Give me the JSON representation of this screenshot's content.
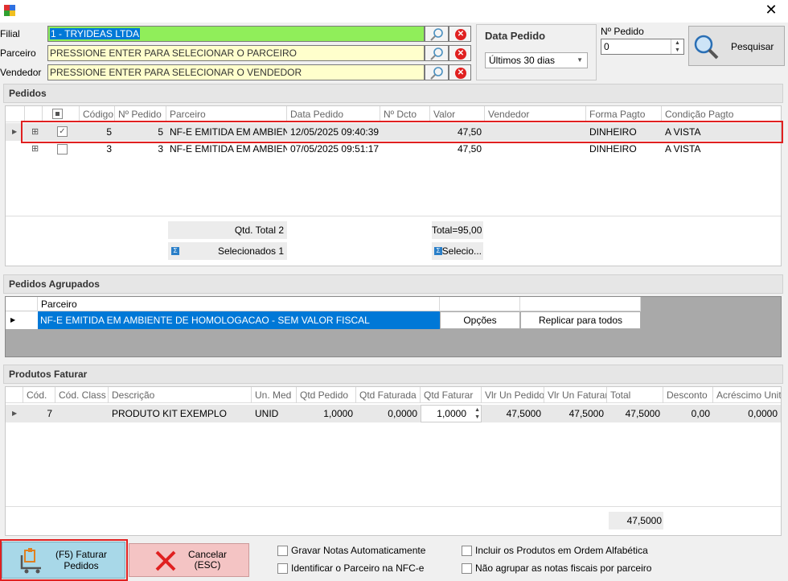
{
  "labels": {
    "filial": "Filial",
    "parceiro": "Parceiro",
    "vendedor": "Vendedor",
    "nro_pedido": "Nº Pedido",
    "data_pedido": "Data Pedido"
  },
  "fields": {
    "filial": "1 - TRYIDEAS LTDA",
    "parceiro": "PRESSIONE ENTER PARA SELECIONAR O PARCEIRO",
    "vendedor": "PRESSIONE ENTER PARA SELECIONAR O VENDEDOR",
    "nro_pedido": "0",
    "data_pedido_option": "Últimos 30 dias"
  },
  "search_button": "Pesquisar",
  "pedidos": {
    "title": "Pedidos",
    "columns": [
      "Código",
      "Nº Pedido",
      "Parceiro",
      "Data Pedido",
      "Nº Dcto",
      "Valor",
      "Vendedor",
      "Forma Pagto",
      "Condição Pagto"
    ],
    "rows": [
      {
        "checked": true,
        "codigo": "5",
        "nro": "5",
        "parceiro": "NF-E EMITIDA EM AMBIEN...",
        "data": "12/05/2025 09:40:39",
        "dcto": "",
        "valor": "47,50",
        "vendedor": "",
        "forma": "DINHEIRO",
        "condicao": "A VISTA"
      },
      {
        "checked": false,
        "codigo": "3",
        "nro": "3",
        "parceiro": "NF-E EMITIDA EM AMBIEN...",
        "data": "07/05/2025 09:51:17",
        "dcto": "",
        "valor": "47,50",
        "vendedor": "",
        "forma": "DINHEIRO",
        "condicao": "A VISTA"
      }
    ],
    "qtd_total": "Qtd. Total 2",
    "selecionados": "Selecionados 1",
    "total": "Total=95,00",
    "selecio": "Selecio..."
  },
  "agrupados": {
    "title": "Pedidos Agrupados",
    "col_parceiro": "Parceiro",
    "row_parceiro": "NF-E EMITIDA EM AMBIENTE DE HOMOLOGACAO - SEM VALOR FISCAL",
    "opcoes": "Opções",
    "replicar": "Replicar para todos"
  },
  "produtos": {
    "title": "Produtos Faturar",
    "columns": [
      "Cód.",
      "Cód. Class",
      "Descrição",
      "Un. Med",
      "Qtd Pedido",
      "Qtd Faturada",
      "Qtd Faturar",
      "Vlr Un Pedido",
      "Vlr Un Faturar",
      "Total",
      "Desconto",
      "Acréscimo Unit."
    ],
    "row": {
      "cod": "7",
      "cod_class": "",
      "descricao": "PRODUTO KIT EXEMPLO",
      "un": "UNID",
      "qtd_pedido": "1,0000",
      "qtd_faturada": "0,0000",
      "qtd_faturar": "1,0000",
      "vlr_un_pedido": "47,5000",
      "vlr_un_faturar": "47,5000",
      "total": "47,5000",
      "desconto": "0,00",
      "acrescimo": "0,0000"
    },
    "footer_total": "47,5000"
  },
  "bottom": {
    "faturar": "(F5) Faturar\nPedidos",
    "cancelar": "Cancelar\n(ESC)",
    "gravar": "Gravar Notas Automaticamente",
    "identificar": "Identificar o Parceiro na NFC-e",
    "incluir": "Incluir os Produtos em Ordem Alfabética",
    "nao_agrupar": "Não agrupar as notas fiscais por parceiro"
  }
}
